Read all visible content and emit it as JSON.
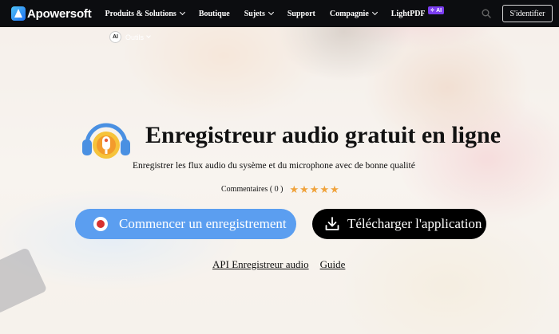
{
  "brand": {
    "name": "Apowersoft"
  },
  "nav": {
    "items": [
      {
        "label": "Produits & Solutions",
        "has_dropdown": true
      },
      {
        "label": "Boutique",
        "has_dropdown": false
      },
      {
        "label": "Sujets",
        "has_dropdown": true
      },
      {
        "label": "Support",
        "has_dropdown": false
      },
      {
        "label": "Compagnie",
        "has_dropdown": true
      },
      {
        "label": "LightPDF",
        "badge": "AI"
      }
    ],
    "search_icon": "search-icon",
    "signin_label": "S'identifier"
  },
  "subnav": {
    "ai_label": "AI",
    "label": "Outils"
  },
  "hero": {
    "title": "Enregistreur audio gratuit en ligne",
    "subtitle": "Enregistrer les flux audio du sysème et du microphone avec de bonne qualité",
    "comments_label": "Commentaires ( 0 )",
    "rating_stars": 5,
    "record_button": "Commencer un enregistrement",
    "download_button": "Télécharger l'application",
    "links": [
      "API Enregistreur audio",
      "Guide"
    ]
  },
  "colors": {
    "nav_bg": "#0c0d10",
    "record_button": "#5b9ef0",
    "download_button": "#000000",
    "star": "#f0a33c",
    "ai_badge": "#7b3df0"
  }
}
